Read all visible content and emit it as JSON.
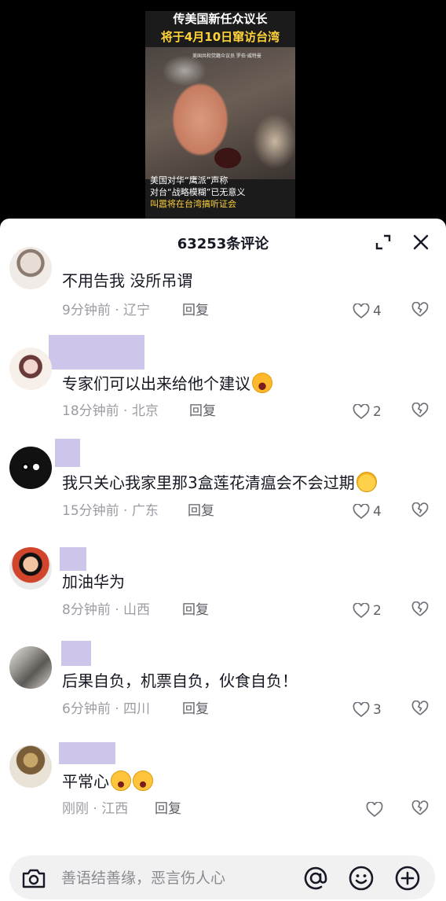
{
  "video": {
    "headline_line1": "传美国新任众议长",
    "headline_line2": "将于4月10日窜访台湾",
    "caption_small": "美国共和党籍众议员 罗伯·威特曼",
    "subtitle_line1": "美国对华“鹰派”声称",
    "subtitle_line2": "对台“战略模糊”已无意义",
    "subtitle_line3": "叫嚣将在台湾搞听证会"
  },
  "sheet": {
    "comment_count": "63253条评论"
  },
  "comments": [
    {
      "text": "不用告我 没所吊谓",
      "time": "9分钟前",
      "location": "辽宁",
      "reply_label": "回复",
      "likes": "4"
    },
    {
      "text": "专家们可以出来给他个建议",
      "time": "18分钟前",
      "location": "北京",
      "reply_label": "回复",
      "likes": "2"
    },
    {
      "text": "我只关心我家里那3盒莲花清瘟会不会过期",
      "time": "15分钟前",
      "location": "广东",
      "reply_label": "回复",
      "likes": "4"
    },
    {
      "text": "加油华为",
      "time": "8分钟前",
      "location": "山西",
      "reply_label": "回复",
      "likes": "2"
    },
    {
      "text": "后果自负，机票自负，伙食自负！",
      "time": "6分钟前",
      "location": "四川",
      "reply_label": "回复",
      "likes": "3"
    },
    {
      "text": "平常心",
      "time": "刚刚",
      "location": "江西",
      "reply_label": "回复",
      "likes": ""
    }
  ],
  "meta_separator": " · ",
  "input": {
    "placeholder": "善语结善缘，恶言伤人心"
  },
  "colors": {
    "username_redaction": "#cdc6ea",
    "meta_gray": "#9b9ca3",
    "text_dark": "#161823"
  }
}
